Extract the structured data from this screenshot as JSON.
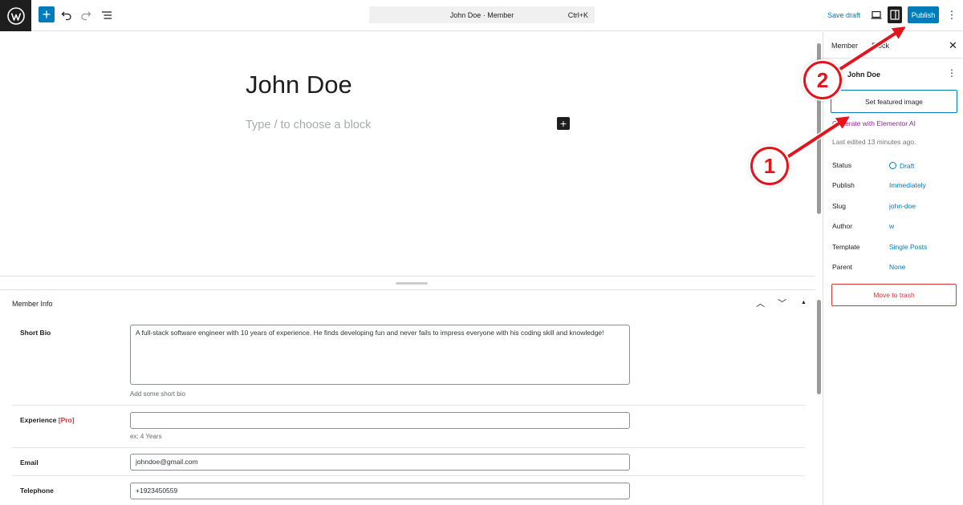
{
  "toolbar": {
    "undo_icon": "undo-icon",
    "redo_icon": "redo-icon",
    "list_view_icon": "list-view-icon",
    "command_title": "John Doe · Member",
    "command_shortcut": "Ctrl+K",
    "save_draft": "Save draft",
    "publish": "Publish",
    "brand_color": "#007cba"
  },
  "editor": {
    "post_title": "John Doe",
    "block_placeholder": "Type / to choose a block"
  },
  "meta_box": {
    "title": "Member Info",
    "fields": [
      {
        "label": "Short Bio",
        "value": "A full-stack software engineer with 10 years of experience. He finds developing fun and never fails to impress everyone with his coding skill and knowledge!",
        "hint": "Add some short bio"
      },
      {
        "label": "Experience",
        "pro": "[Pro]",
        "value": "",
        "hint": "ex: 4 Years"
      },
      {
        "label": "Email",
        "value": "johndoe@gmail.com"
      },
      {
        "label": "Telephone",
        "value": "+1923450559"
      }
    ]
  },
  "sidebar": {
    "tabs": [
      "Member",
      "Block"
    ],
    "doc_title": "John Doe",
    "featured_image": "Set featured image",
    "elementor": "Generate with Elementor AI",
    "last_edited": "Last edited 13 minutes ago.",
    "rows": [
      {
        "key": "Status",
        "value": "Draft"
      },
      {
        "key": "Publish",
        "value": "Immediately"
      },
      {
        "key": "Slug",
        "value": "john-doe"
      },
      {
        "key": "Author",
        "value": "w"
      },
      {
        "key": "Template",
        "value": "Single Posts"
      },
      {
        "key": "Parent",
        "value": "None"
      }
    ],
    "trash": "Move to trash"
  },
  "annotations": {
    "marker_1": "1",
    "marker_2": "2",
    "color": "#e3141b"
  }
}
